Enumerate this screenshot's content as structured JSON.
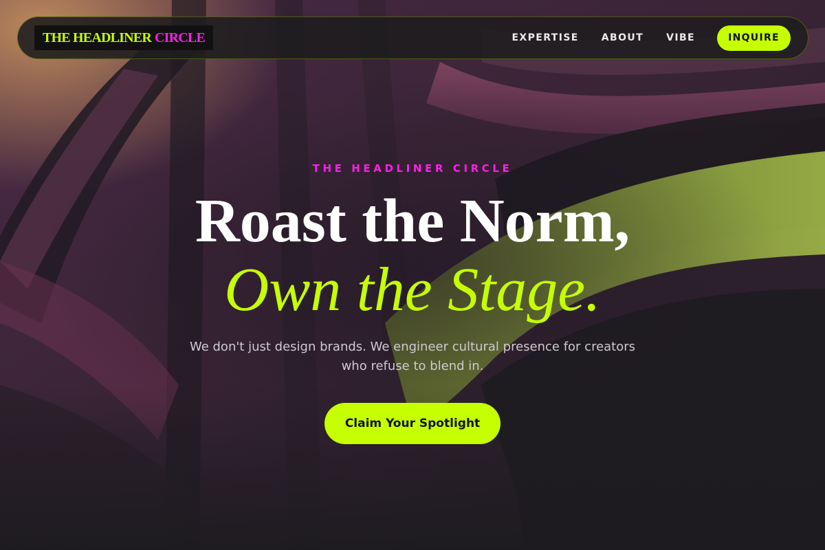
{
  "brand": {
    "name_part1": "THE HEADLINER",
    "name_part2": "CIRCLE"
  },
  "nav": {
    "links": [
      {
        "label": "EXPERTISE"
      },
      {
        "label": "ABOUT"
      },
      {
        "label": "VIBE"
      }
    ],
    "cta_label": "INQUIRE"
  },
  "hero": {
    "eyebrow": "THE HEADLINER CIRCLE",
    "headline_line1": "Roast the Norm,",
    "headline_line2": "Own the Stage.",
    "subtitle_line1": "We don't just design brands. We engineer cultural presence for creators",
    "subtitle_line2": "who refuse to blend in.",
    "cta_label": "Claim Your Spotlight"
  },
  "colors": {
    "accent_lime": "#c6ff00",
    "accent_magenta": "#ff1ee8",
    "background": "#1d1b20"
  }
}
